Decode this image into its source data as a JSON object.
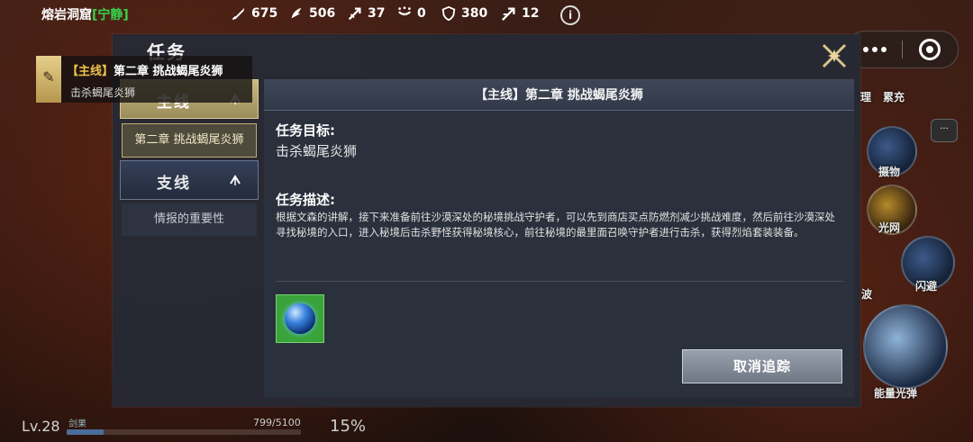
{
  "hud": {
    "location": "熔岩洞窟",
    "location_status": "[宁静]",
    "stats": [
      {
        "icon": "attack-icon",
        "value": "675"
      },
      {
        "icon": "defense-icon",
        "value": "506"
      },
      {
        "icon": "crit-icon",
        "value": "37"
      },
      {
        "icon": "dodge-icon",
        "value": "0"
      },
      {
        "icon": "shield-icon",
        "value": "380"
      },
      {
        "icon": "speed-icon",
        "value": "12"
      }
    ],
    "info_glyph": "i"
  },
  "tracking": {
    "flag_glyph": "✎",
    "tag": "【主线】",
    "title": "第二章 挑战蝎尾炎狮",
    "subtitle": "击杀蝎尾炎狮"
  },
  "dialog": {
    "title": "任务",
    "nav": {
      "main_label": "主线",
      "main_sub": "第二章 挑战蝎尾炎狮",
      "side_label": "支线",
      "side_sub": "情报的重要性"
    },
    "panel": {
      "header": "【主线】第二章 挑战蝎尾炎狮",
      "goal_heading": "任务目标:",
      "goal_text": "击杀蝎尾炎狮",
      "desc_heading": "任务描述:",
      "desc_text": "根据文森的讲解，接下来准备前往沙漠深处的秘境挑战守护者，可以先到商店买点防燃剂减少挑战难度，然后前往沙漠深处寻找秘境的入口，进入秘境后击杀野怪获得秘境核心，前往秘境的最里面召唤守护者进行击杀，获得烈焰套装装备。",
      "reward_icon": "blue-orb-icon",
      "untrack_button": "取消追踪"
    }
  },
  "skills": {
    "items": [
      {
        "label": "摄物"
      },
      {
        "label": "光网"
      },
      {
        "label": "闪避"
      },
      {
        "label": "能量光弹"
      }
    ],
    "partial_labels": [
      "理",
      "累充",
      "波"
    ]
  },
  "chat": {
    "glyph": "···"
  },
  "bottom": {
    "level": "Lv.28",
    "xp_title": "剑果",
    "xp_text": "799/5100",
    "xp_fraction": 0.157,
    "percent": "15%"
  },
  "colors": {
    "accent_gold": "#c9b983",
    "status_green": "#37d14a",
    "reward_green": "#3aa33a"
  }
}
